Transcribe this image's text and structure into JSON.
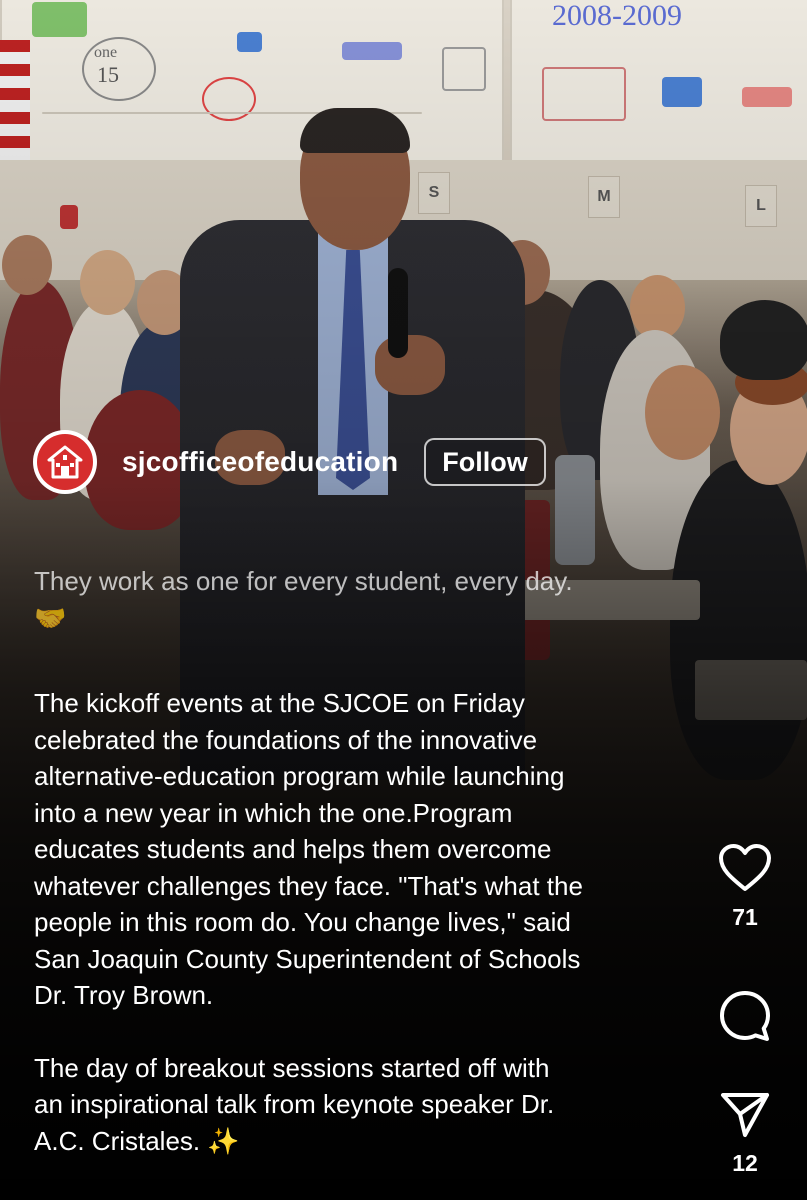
{
  "post": {
    "username": "sjcofficeofeducation",
    "follow_label": "Follow",
    "caption_lead": "They work as one for every student, every day.",
    "caption_lead_emoji": "🤝",
    "caption_para1": [
      "The kickoff events at the SJCOE on Friday",
      "celebrated the foundations of the innovative",
      "alternative-education program while launching",
      "into a new year in which the one.Program",
      "educates students and helps them overcome",
      "whatever challenges they face. \"That's what the",
      "people in this room do. You change lives,\" said",
      "San Joaquin County Superintendent of Schools",
      "Dr. Troy Brown."
    ],
    "caption_para2": [
      " The day of breakout sessions started off with",
      "an inspirational talk from keynote speaker Dr.",
      "A.C. Cristales. ✨"
    ]
  },
  "actions": {
    "like_icon": "heart-icon",
    "like_count": "71",
    "comment_icon": "comment-icon",
    "share_icon": "send-icon",
    "share_count": "12"
  },
  "photo": {
    "banner_text": "2008-2009",
    "banner_one": "one",
    "banner_15": "15",
    "sign_s": "S",
    "sign_m": "M",
    "sign_l": "L"
  },
  "colors": {
    "avatar_red": "#d62d2d",
    "text": "#ffffff",
    "background": "#0d0d0d"
  }
}
